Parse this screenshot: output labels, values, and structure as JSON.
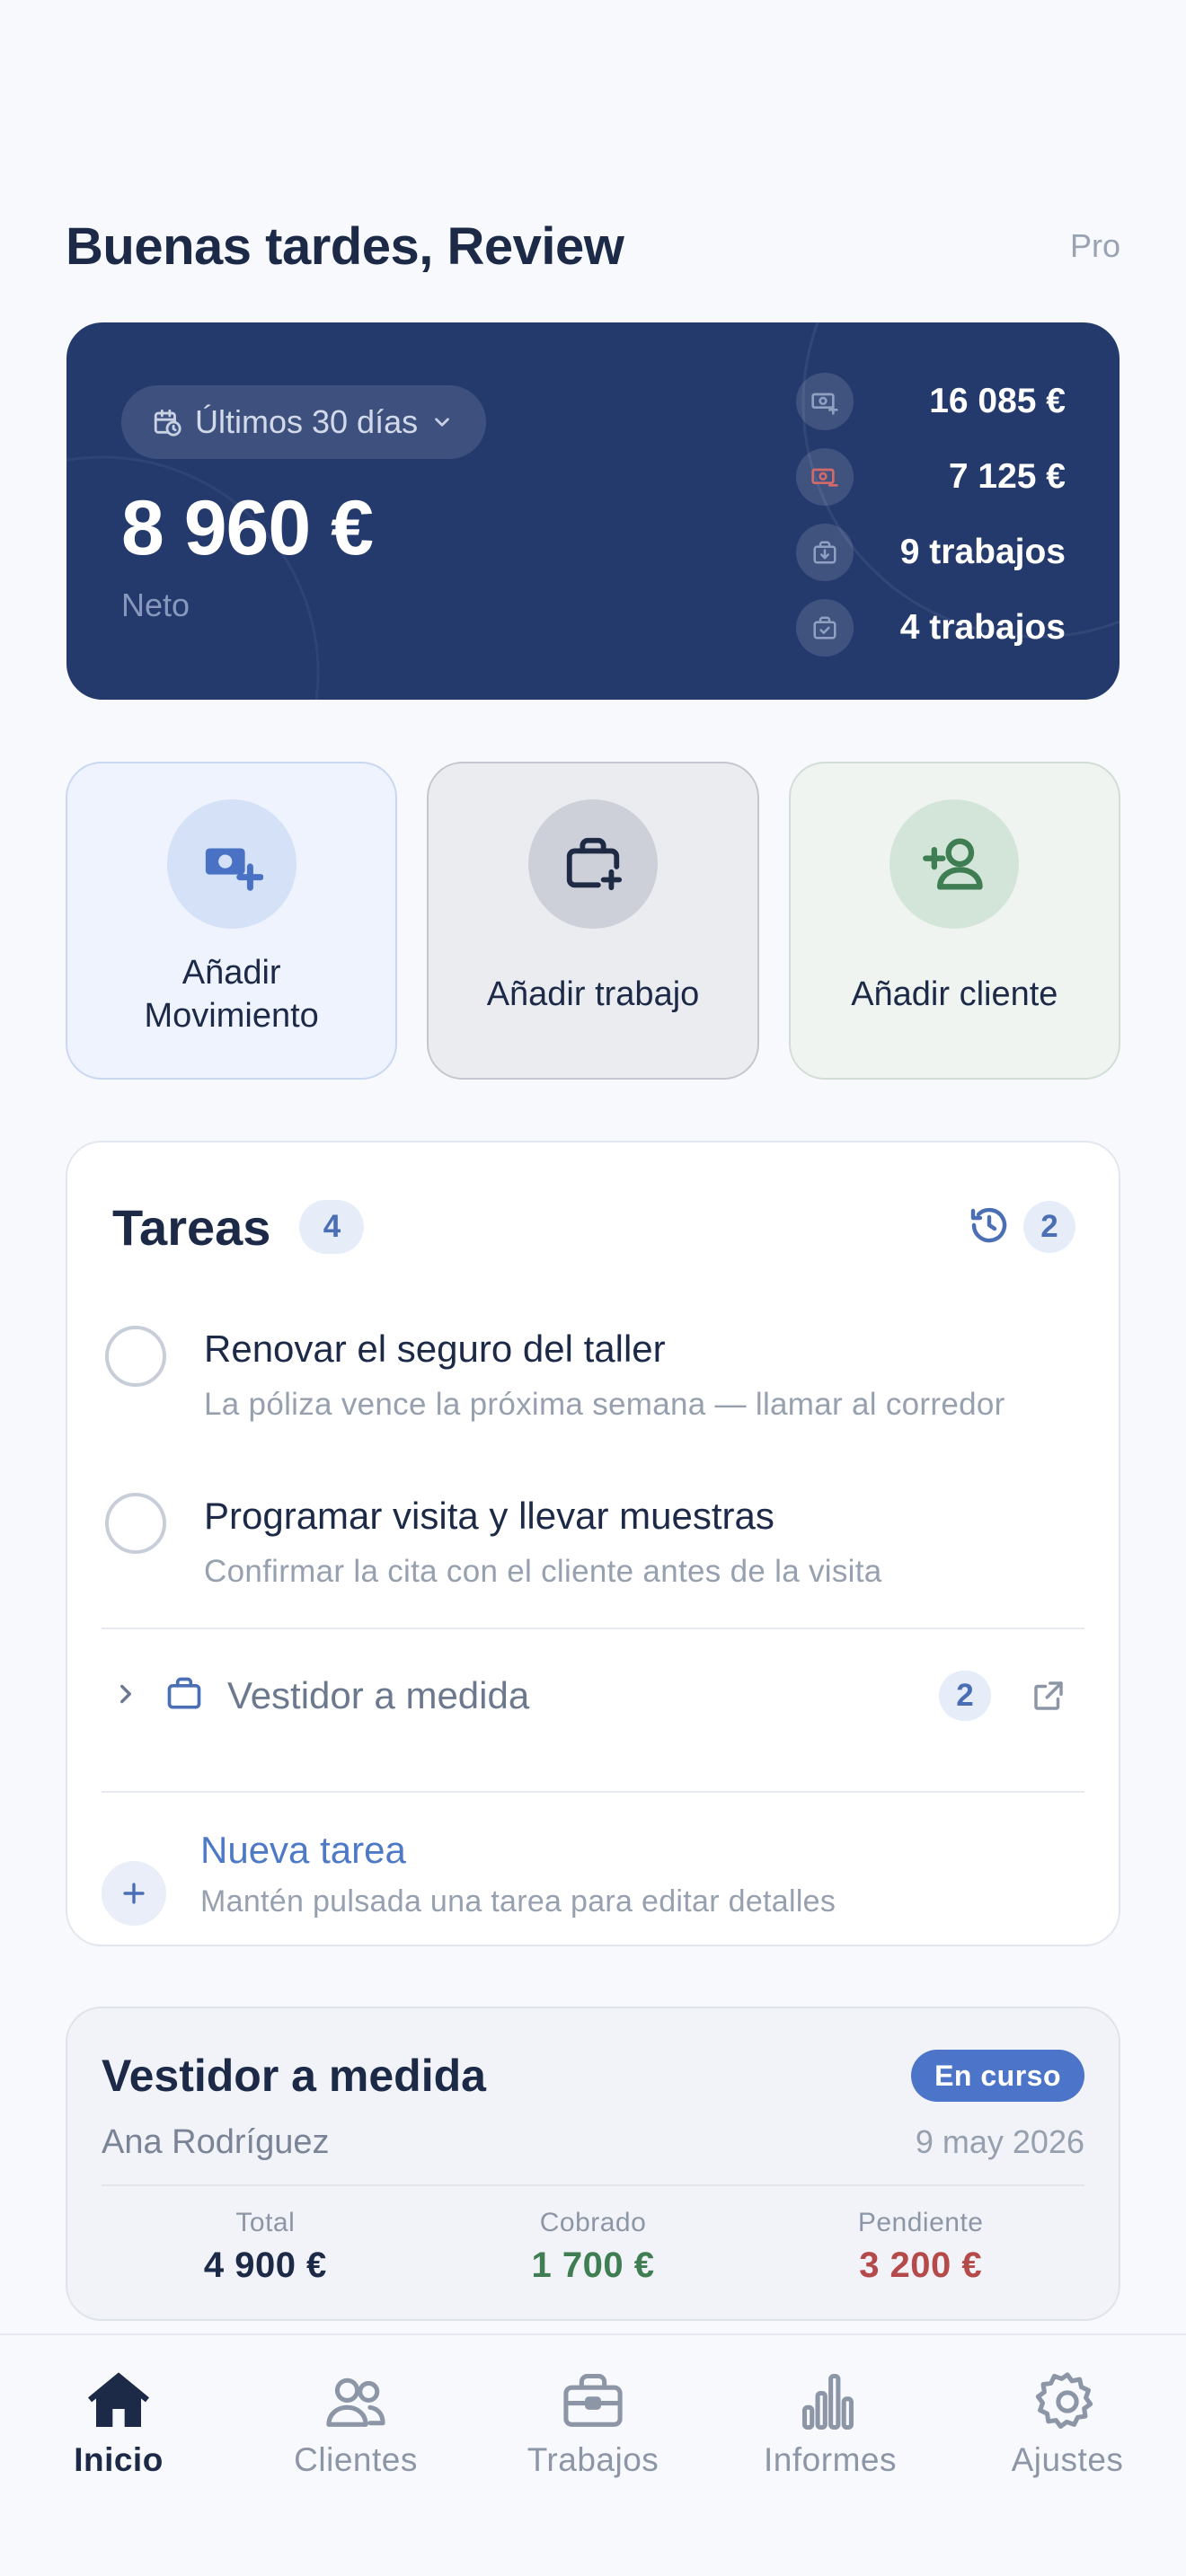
{
  "header": {
    "greeting": "Buenas tardes, Review",
    "plan": "Pro"
  },
  "summary": {
    "range_label": "Últimos 30 días",
    "net_amount": "8 960 €",
    "net_label": "Neto",
    "stats": [
      {
        "icon": "income-icon",
        "value": "16 085 €"
      },
      {
        "icon": "expense-icon",
        "value": "7 125 €"
      },
      {
        "icon": "jobs-in-progress-icon",
        "value": "9 trabajos"
      },
      {
        "icon": "jobs-done-icon",
        "value": "4 trabajos"
      }
    ]
  },
  "quick_actions": [
    {
      "label": "Añadir Movimiento",
      "icon": "add-money-icon"
    },
    {
      "label": "Añadir trabajo",
      "icon": "add-job-icon"
    },
    {
      "label": "Añadir cliente",
      "icon": "add-user-icon"
    }
  ],
  "tasks": {
    "title": "Tareas",
    "count": "4",
    "history_count": "2",
    "items": [
      {
        "title": "Renovar el seguro del taller",
        "subtitle": "La póliza vence la próxima semana — llamar al corredor"
      },
      {
        "title": "Programar visita y llevar muestras",
        "subtitle": "Confirmar la cita con el cliente antes de la visita"
      }
    ],
    "group": {
      "name": "Vestidor a medida",
      "count": "2"
    },
    "new_task": {
      "title": "Nueva tarea",
      "hint": "Mantén pulsada una tarea para editar detalles"
    }
  },
  "job_card": {
    "title": "Vestidor a medida",
    "status": "En curso",
    "client": "Ana Rodríguez",
    "date": "9 may 2026",
    "total_label": "Total",
    "total_value": "4 900 €",
    "paid_label": "Cobrado",
    "paid_value": "1 700 €",
    "pending_label": "Pendiente",
    "pending_value": "3 200 €"
  },
  "tabs": [
    {
      "label": "Inicio",
      "icon": "home-icon",
      "active": true
    },
    {
      "label": "Clientes",
      "icon": "users-icon",
      "active": false
    },
    {
      "label": "Trabajos",
      "icon": "briefcase-icon",
      "active": false
    },
    {
      "label": "Informes",
      "icon": "bar-chart-icon",
      "active": false
    },
    {
      "label": "Ajustes",
      "icon": "gear-icon",
      "active": false
    }
  ],
  "colors": {
    "hero_bg": "#243a6d",
    "accent": "#4c74c8",
    "paid": "#3f7d52",
    "pending": "#b54a4a",
    "text_dark": "#1c2a48"
  }
}
